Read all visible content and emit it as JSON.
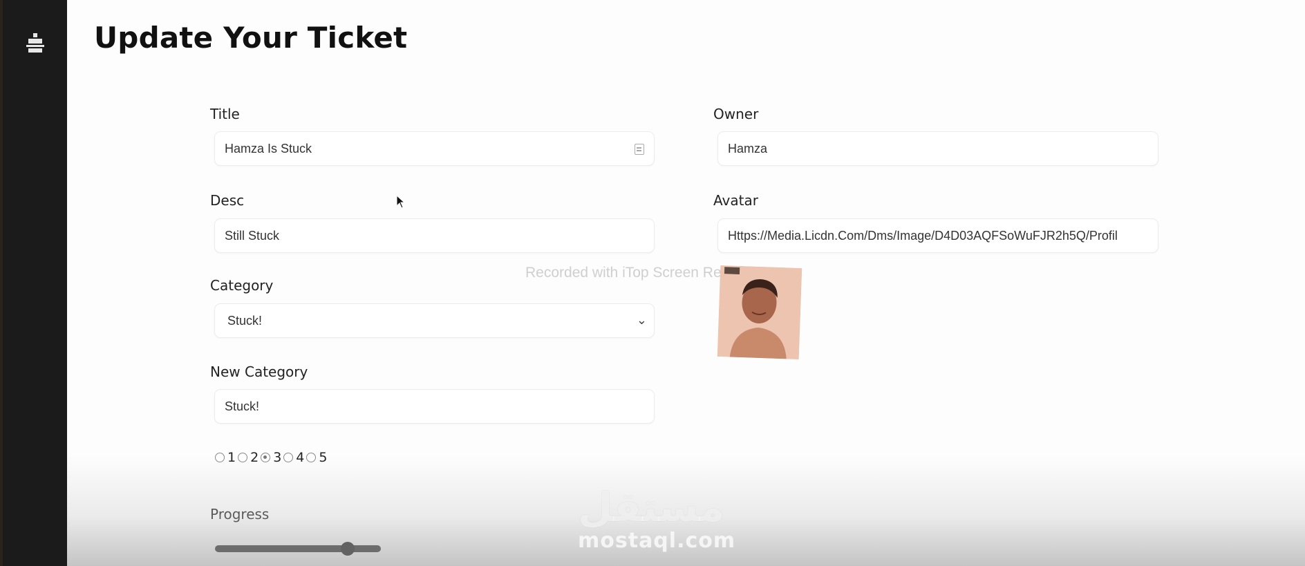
{
  "page": {
    "title": "Update Your Ticket"
  },
  "sidebar": {
    "icon": "stack-icon"
  },
  "form": {
    "title": {
      "label": "Title",
      "value": "Hamza Is Stuck"
    },
    "owner": {
      "label": "Owner",
      "value": "Hamza"
    },
    "desc": {
      "label": "Desc",
      "value": "Still Stuck"
    },
    "avatar": {
      "label": "Avatar",
      "value": "Https://Media.Licdn.Com/Dms/Image/D4D03AQFSoWuFJR2h5Q/Profil"
    },
    "category": {
      "label": "Category",
      "value": "Stuck!"
    },
    "new_category": {
      "label": "New Category",
      "value": "Stuck!"
    },
    "priority": {
      "options": [
        "1",
        "2",
        "3",
        "4",
        "5"
      ],
      "selected": "3"
    },
    "progress": {
      "label": "Progress",
      "value_fraction": 0.8
    }
  },
  "overlay": {
    "recording_text": "Recorded with iTop Screen Recorder",
    "logo_text": "مستقل",
    "site_text": "mostaql.com"
  }
}
